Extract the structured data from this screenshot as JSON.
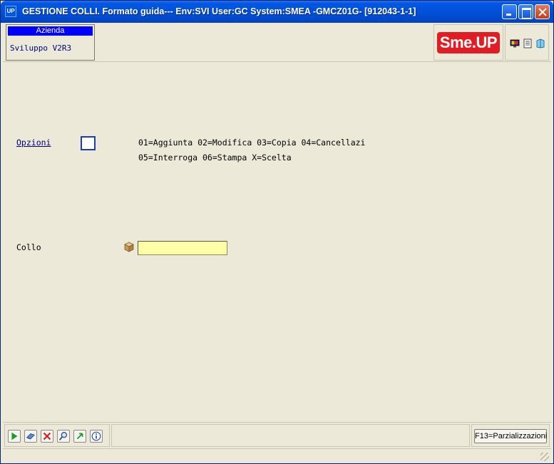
{
  "window": {
    "app_icon_text": "UP",
    "title": "GESTIONE COLLI.  Formato guida--- Env:SVI User:GC System:SMEA -GMCZ01G- [912043-1-1]"
  },
  "header": {
    "company_label": "Azienda",
    "company_value": "Sviluppo V2R3",
    "logo_text": "Sme.UP",
    "tool_icons": [
      "monitor-icon",
      "document-icon",
      "book-icon"
    ]
  },
  "main": {
    "options": {
      "label": "Opzioni",
      "value": "",
      "line1": "01=Aggiunta 02=Modifica 03=Copia 04=Cancellazi",
      "line2": "05=Interroga 06=Stampa X=Scelta"
    },
    "collo": {
      "label": "Collo",
      "value": "",
      "icon": "package-icon"
    }
  },
  "footer": {
    "toolbar_icons": [
      "execute-icon",
      "eraser-icon",
      "cancel-icon",
      "search-icon",
      "refresh-icon",
      "info-icon"
    ],
    "fkey_label": "F13=Parzializzazioni"
  },
  "colors": {
    "titlebar": "#0050d8",
    "background": "#ece9d8",
    "company_header": "#0000ff",
    "logo": "#e31b23",
    "input_highlight": "#ffffa6",
    "link": "#000080"
  }
}
